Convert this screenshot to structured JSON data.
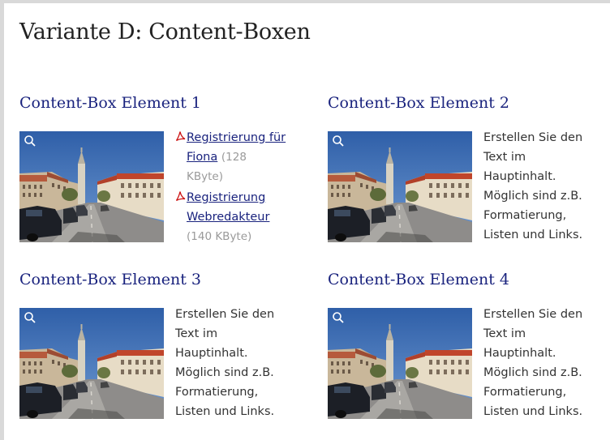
{
  "page": {
    "title": "Variante D: Content-Boxen"
  },
  "boxes": [
    {
      "title": "Content-Box Element 1",
      "image_icon": "zoom-icon",
      "downloads": [
        {
          "link_line1": "Registrierung für",
          "link_line2": "Fiona",
          "size_a": "(128",
          "size_b": "KByte)",
          "icon": "pdf-icon"
        },
        {
          "link_line1": "Registrierung",
          "link_line2": "Webredakteur",
          "size": "(140 KByte)",
          "icon": "pdf-icon"
        }
      ]
    },
    {
      "title": "Content-Box Element 2",
      "image_icon": "zoom-icon",
      "text_lines": [
        "Erstellen Sie den",
        "Text im",
        "Hauptinhalt.",
        "Möglich sind z.B.",
        "Formatierung,",
        "Listen und Links."
      ]
    },
    {
      "title": "Content-Box Element 3",
      "image_icon": "zoom-icon",
      "text_lines": [
        "Erstellen Sie den",
        "Text im",
        "Hauptinhalt.",
        "Möglich sind z.B.",
        "Formatierung,",
        "Listen und Links."
      ]
    },
    {
      "title": "Content-Box Element 4",
      "image_icon": "zoom-icon",
      "text_lines": [
        "Erstellen Sie den",
        "Text im",
        "Hauptinhalt.",
        "Möglich sind z.B.",
        "Formatierung,",
        "Listen und Links."
      ]
    }
  ],
  "colors": {
    "heading": "#1a237e",
    "body_text": "#333333",
    "muted": "#9a9a9a",
    "pdf_red": "#cc1111",
    "frame": "#d9d9d9"
  }
}
